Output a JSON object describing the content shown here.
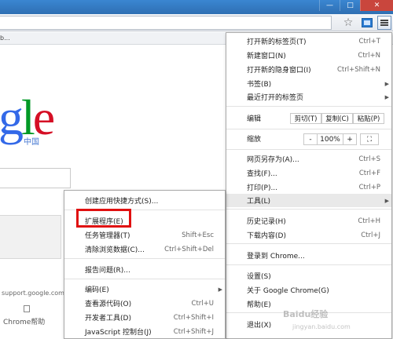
{
  "window": {
    "controls": {
      "minimize": "—",
      "maximize": "□",
      "close": "✕"
    }
  },
  "toolbar": {
    "star_icon": "star-icon",
    "menu_icon": "hamburger-icon"
  },
  "bookmarks": {
    "text": "b..."
  },
  "page": {
    "logo_letters": [
      {
        "char": "g",
        "color": "#3369e8"
      },
      {
        "char": "l",
        "color": "#009925"
      },
      {
        "char": "e",
        "color": "#d50f25"
      }
    ],
    "logo_sub": "中国",
    "tile_text": "support.google.com",
    "help_label": "Chrome帮助"
  },
  "main_menu": {
    "items": [
      {
        "label": "打开新的标签页(T)",
        "shortcut": "Ctrl+T"
      },
      {
        "label": "新建窗口(N)",
        "shortcut": "Ctrl+N"
      },
      {
        "label": "打开新的隐身窗口(I)",
        "shortcut": "Ctrl+Shift+N"
      },
      {
        "label": "书签(B)",
        "shortcut": ""
      },
      {
        "label": "最近打开的标签页",
        "shortcut": ""
      },
      {
        "label": "编辑",
        "shortcut": ""
      },
      {
        "label": "缩放",
        "shortcut": ""
      },
      {
        "label": "网页另存为(A)...",
        "shortcut": "Ctrl+S"
      },
      {
        "label": "查找(F)...",
        "shortcut": "Ctrl+F"
      },
      {
        "label": "打印(P)...",
        "shortcut": "Ctrl+P"
      },
      {
        "label": "工具(L)",
        "shortcut": ""
      },
      {
        "label": "历史记录(H)",
        "shortcut": "Ctrl+H"
      },
      {
        "label": "下载内容(D)",
        "shortcut": "Ctrl+J"
      },
      {
        "label": "登录到 Chrome...",
        "shortcut": ""
      },
      {
        "label": "设置(S)",
        "shortcut": ""
      },
      {
        "label": "关于 Google Chrome(G)",
        "shortcut": ""
      },
      {
        "label": "帮助(E)",
        "shortcut": ""
      },
      {
        "label": "退出(X)",
        "shortcut": ""
      }
    ],
    "edit": {
      "cut": "剪切(T)",
      "copy": "复制(C)",
      "paste": "粘贴(P)"
    },
    "zoom": {
      "minus": "-",
      "value": "100%",
      "plus": "+",
      "fullscreen": "⛶"
    }
  },
  "sub_menu": {
    "items": [
      {
        "label": "创建应用快捷方式(S)...",
        "shortcut": ""
      },
      {
        "label": "扩展程序(E)",
        "shortcut": ""
      },
      {
        "label": "任务管理器(T)",
        "shortcut": "Shift+Esc"
      },
      {
        "label": "清除浏览数据(C)...",
        "shortcut": "Ctrl+Shift+Del"
      },
      {
        "label": "报告问题(R)...",
        "shortcut": ""
      },
      {
        "label": "编码(E)",
        "shortcut": ""
      },
      {
        "label": "查看源代码(O)",
        "shortcut": "Ctrl+U"
      },
      {
        "label": "开发者工具(D)",
        "shortcut": "Ctrl+Shift+I"
      },
      {
        "label": "JavaScript 控制台(J)",
        "shortcut": "Ctrl+Shift+J"
      }
    ]
  },
  "highlight_color": "#e01010",
  "watermark": {
    "text": "Baidu经验",
    "url": "jingyan.baidu.com"
  }
}
